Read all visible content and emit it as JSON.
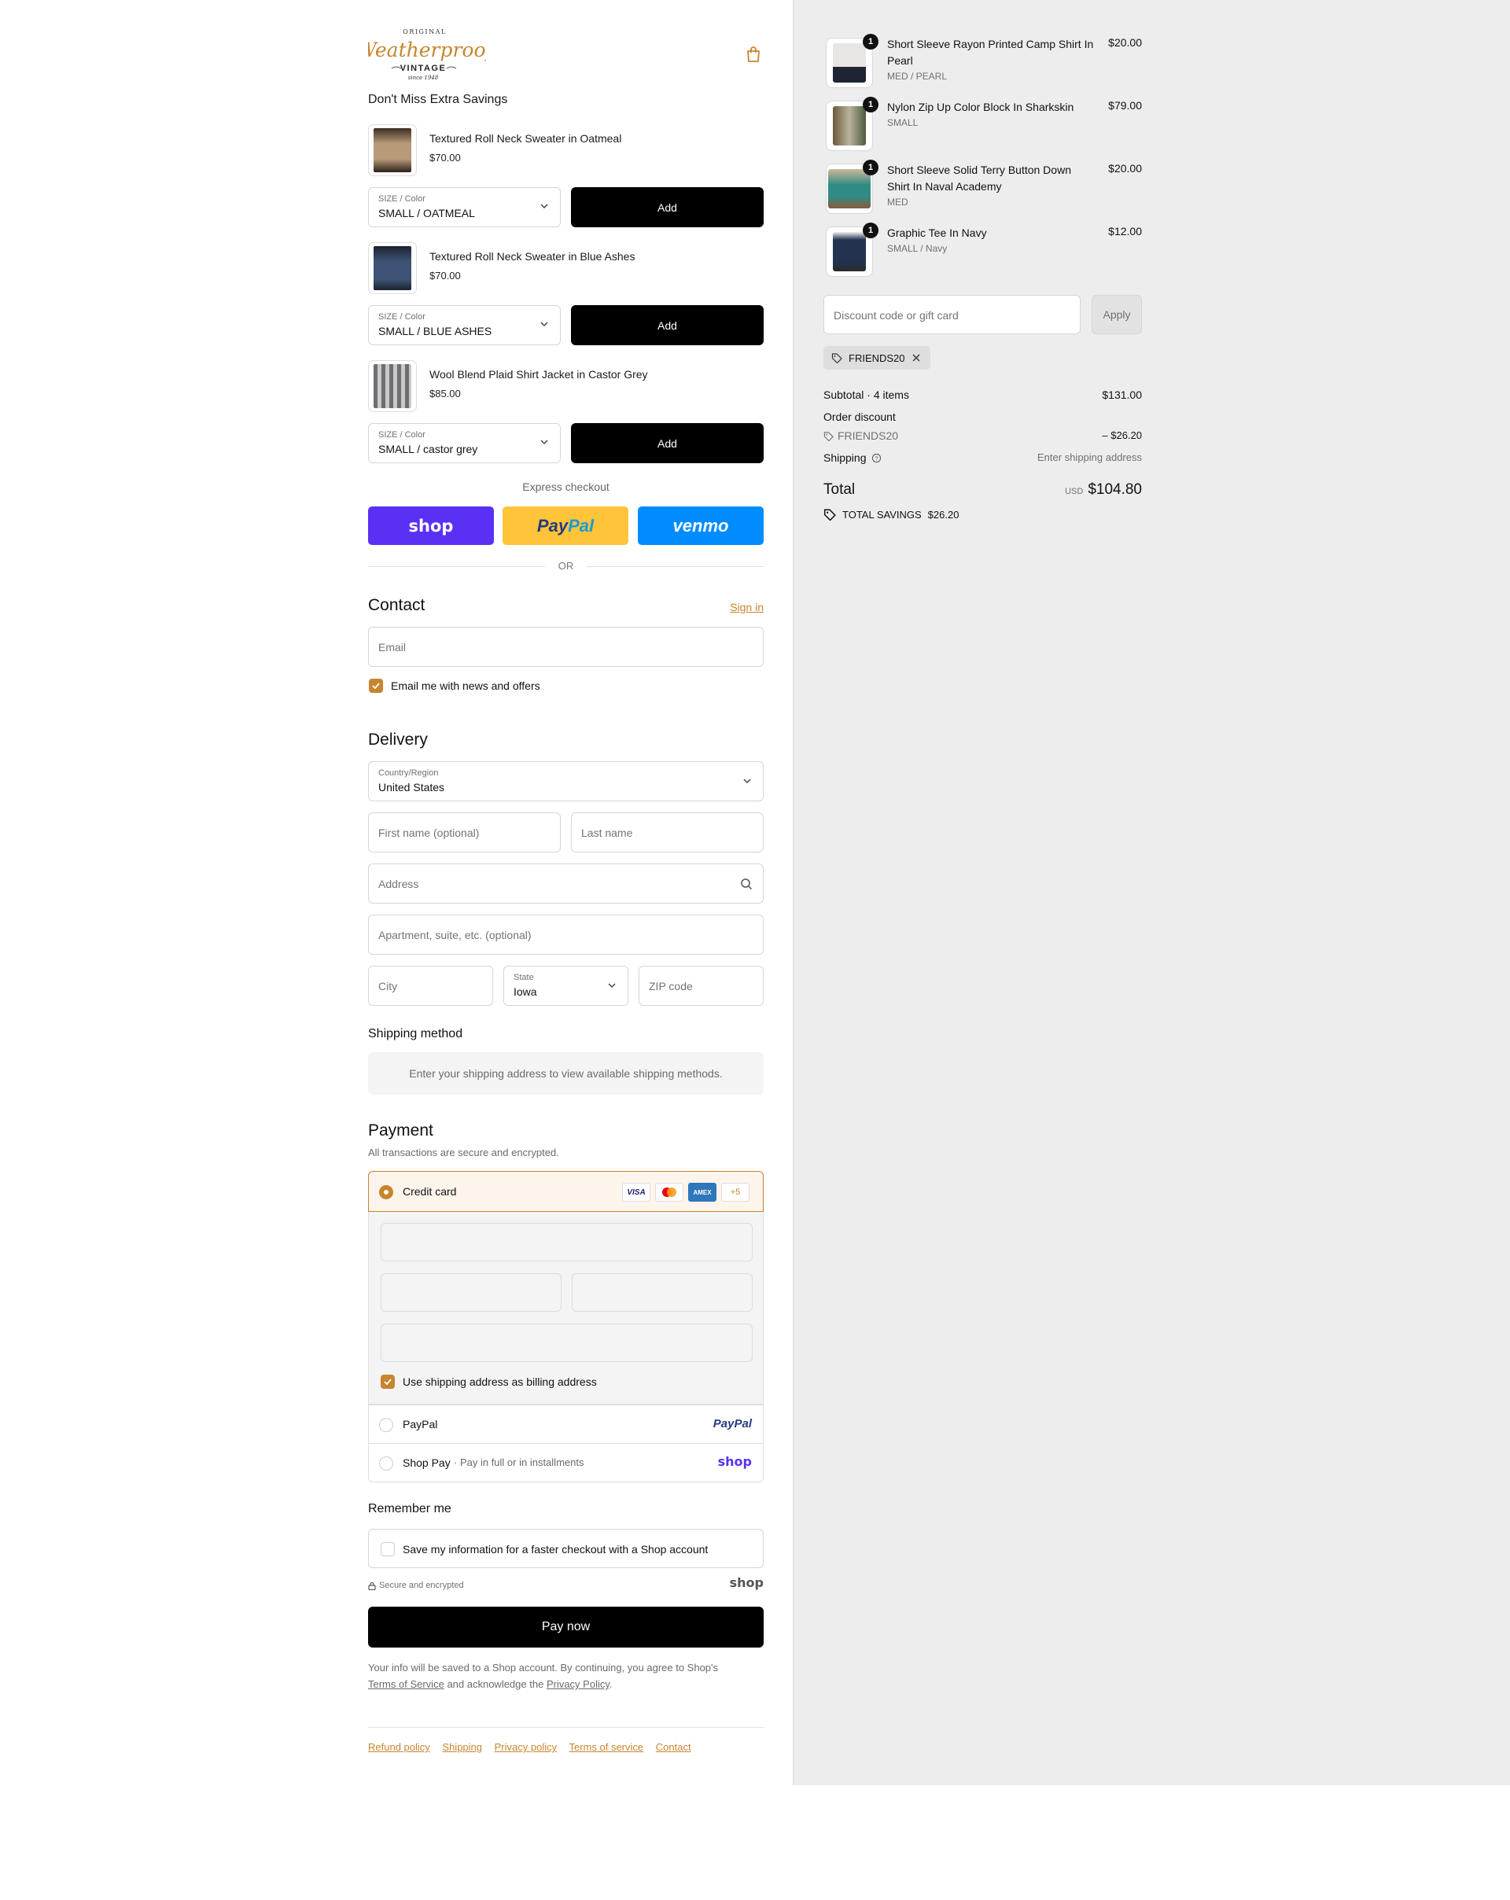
{
  "brand": {
    "top_word": "ORIGINAL",
    "script_word": "Weatherproof",
    "sub_word": "VINTAGE",
    "since": "since 1948"
  },
  "upsell": {
    "title": "Don't Miss Extra Savings",
    "items": [
      {
        "name": "Textured Roll Neck Sweater in Oatmeal",
        "price": "$70.00",
        "select_label": "SIZE / Color",
        "select_value": "SMALL / OATMEAL",
        "button": "Add",
        "image_color": "#b89a79"
      },
      {
        "name": "Textured Roll Neck Sweater in Blue Ashes",
        "price": "$70.00",
        "select_label": "SIZE / Color",
        "select_value": "SMALL / BLUE ASHES",
        "button": "Add",
        "image_color": "#3d5375"
      },
      {
        "name": "Wool Blend Plaid Shirt Jacket in Castor Grey",
        "price": "$85.00",
        "select_label": "SIZE / Color",
        "select_value": "SMALL / castor grey",
        "button": "Add",
        "image_color": "#8c8d90"
      }
    ]
  },
  "express": {
    "label": "Express checkout",
    "shop": "shop",
    "paypal_a": "Pay",
    "paypal_b": "Pal",
    "venmo": "venmo",
    "or": "OR"
  },
  "contact": {
    "title": "Contact",
    "sign_in": "Sign in",
    "email_placeholder": "Email",
    "news_label": "Email me with news and offers",
    "news_checked": true
  },
  "delivery": {
    "title": "Delivery",
    "country_label": "Country/Region",
    "country_value": "United States",
    "first_name_placeholder": "First name (optional)",
    "last_name_placeholder": "Last name",
    "address_placeholder": "Address",
    "apartment_placeholder": "Apartment, suite, etc. (optional)",
    "city_placeholder": "City",
    "state_label": "State",
    "state_value": "Iowa",
    "zip_placeholder": "ZIP code"
  },
  "shipping_method": {
    "title": "Shipping method",
    "note": "Enter your shipping address to view available shipping methods."
  },
  "payment": {
    "title": "Payment",
    "subtitle": "All transactions are secure and encrypted.",
    "credit_card_label": "Credit card",
    "cards": [
      "VISA",
      "MC",
      "AMEX"
    ],
    "more_cards": "+5",
    "billing_label": "Use shipping address as billing address",
    "paypal_label": "PayPal",
    "paypal_logo": "PayPal",
    "shoppay_label": "Shop Pay",
    "shoppay_sub": "Pay in full or in installments",
    "shoppay_logo": "shop"
  },
  "remember": {
    "title": "Remember me",
    "save_label": "Save my information for a faster checkout with a Shop account",
    "secure_label": "Secure and encrypted",
    "shop_logo": "shop"
  },
  "pay_now": "Pay now",
  "legal": {
    "text_a": "Your info will be saved to a Shop account. By continuing, you agree to Shop's",
    "tos": "Terms of Service",
    "text_b": "and acknowledge the",
    "privacy": "Privacy Policy",
    "end": "."
  },
  "footer": [
    "Refund policy",
    "Shipping",
    "Privacy policy",
    "Terms of service",
    "Contact"
  ],
  "cart": {
    "items": [
      {
        "qty": "1",
        "name": "Short Sleeve Rayon Printed Camp Shirt In Pearl",
        "variant": "MED / PEARL",
        "price": "$20.00",
        "image_color": "#e8e6e2"
      },
      {
        "qty": "1",
        "name": "Nylon Zip Up Color Block In Sharkskin",
        "variant": "SMALL",
        "price": "$79.00",
        "image_color": "#7c7a5c"
      },
      {
        "qty": "1",
        "name": "Short Sleeve Solid Terry Button Down Shirt In Naval Academy",
        "variant": "MED",
        "price": "$20.00",
        "image_color": "#2f8c84"
      },
      {
        "qty": "1",
        "name": "Graphic Tee In Navy",
        "variant": "SMALL / Navy",
        "price": "$12.00",
        "image_color": "#22324f"
      }
    ],
    "discount_placeholder": "Discount code or gift card",
    "apply": "Apply",
    "applied_code": "FRIENDS20",
    "subtotal_label": "Subtotal · 4 items",
    "subtotal_value": "$131.00",
    "order_discount_label": "Order discount",
    "discount_code": "FRIENDS20",
    "discount_value": "– $26.20",
    "shipping_label": "Shipping",
    "shipping_value": "Enter shipping address",
    "total_label": "Total",
    "currency": "USD",
    "total_value": "$104.80",
    "savings_label": "TOTAL SAVINGS",
    "savings_value": "$26.20"
  },
  "colors": {
    "accent": "#c7852f",
    "shop_purple": "#5a31f4",
    "paypal_yellow": "#ffc439",
    "venmo_blue": "#008cff",
    "sidebar_bg": "#ededed"
  }
}
